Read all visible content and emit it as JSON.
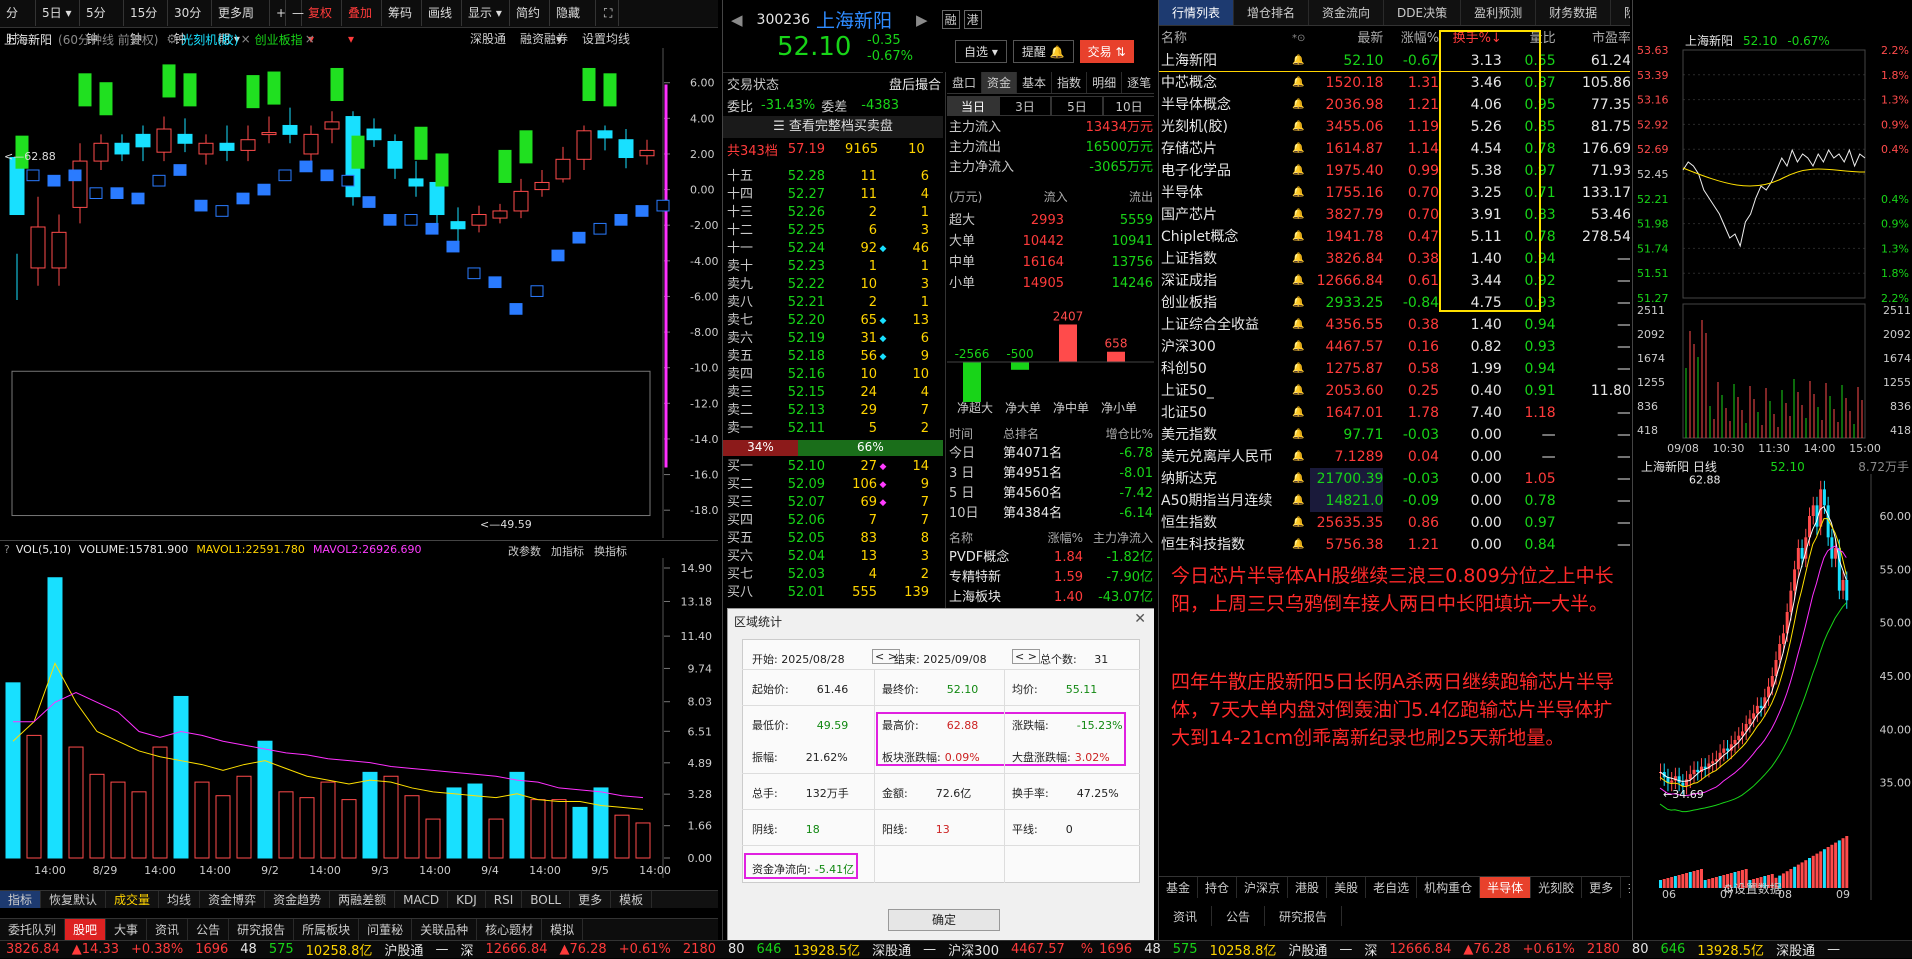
{
  "toolbar": {
    "items": [
      "分时",
      "5日",
      "5分钟",
      "15分钟",
      "30分钟",
      "更多周期",
      "+",
      "—",
      "复权",
      "叠加",
      "筹码",
      "画线",
      "显示",
      "简约",
      "隐藏"
    ]
  },
  "left_chart": {
    "title": "上海新阳",
    "subtitle": "(60分钟线 前复权)",
    "tag1": "光刻机(胶)",
    "tag2": "创业板指",
    "menu": [
      "深股通",
      "融资融券",
      "设置均线"
    ],
    "high_label": "62.88",
    "low_label": "49.59",
    "y_ticks": [
      "6.00",
      "4.00",
      "2.00",
      "0.00",
      "-2.00",
      "-4.00",
      "-6.00",
      "-8.00",
      "-10.00",
      "-12.00",
      "-14.00",
      "-16.00",
      "-18.00"
    ]
  },
  "vol_chart": {
    "title": "VOL(5,10)",
    "volume": "VOLUME:15781.900",
    "mavol1": "MAVOL1:22591.780",
    "mavol2": "MAVOL2:26926.690",
    "menu": [
      "改参数",
      "加指标",
      "换指标"
    ],
    "y_ticks": [
      "14.90",
      "13.18",
      "11.40",
      "9.74",
      "8.03",
      "6.51",
      "4.89",
      "3.28",
      "1.66",
      "0.00"
    ],
    "x_ticks": [
      "14:00",
      "8/29",
      "14:00",
      "14:00",
      "9/2",
      "14:00",
      "9/3",
      "14:00",
      "9/4",
      "14:00",
      "9/5",
      "14:00"
    ]
  },
  "indicator_tabs": [
    "指标",
    "恢复默认",
    "成交量",
    "均线",
    "资金博弈",
    "资金趋势",
    "两融差额",
    "MACD",
    "KDJ",
    "RSI",
    "BOLL",
    "更多",
    "模板"
  ],
  "bottom_tabs": [
    "委托队列",
    "股吧",
    "大事",
    "资讯",
    "公告",
    "研究报告",
    "所属板块",
    "问董秘",
    "关联品种",
    "核心题材",
    "模拟"
  ],
  "quote": {
    "code": "300236",
    "name": "上海新阳",
    "tag1": "融",
    "tag2": "港",
    "price": "52.10",
    "chg": "-0.35",
    "pct": "-0.67%",
    "btn_watch": "自选",
    "btn_alert": "提醒",
    "btn_trade": "交易",
    "state_label": "交易状态",
    "state": "盘后撮合",
    "wb_label": "委比",
    "wb": "-31.43%",
    "wc_label": "委差",
    "wc": "-4383",
    "full_book": "查看完整档买卖盘",
    "total_label": "共343档",
    "total_price": "57.19",
    "total_vol": "9165",
    "total_n": "10",
    "ratio_sell": "34%",
    "ratio_buy": "66%"
  },
  "sell_book": [
    [
      "十五",
      "52.28",
      "11",
      "6"
    ],
    [
      "十四",
      "52.27",
      "11",
      "4"
    ],
    [
      "十三",
      "52.26",
      "2",
      "1"
    ],
    [
      "十二",
      "52.25",
      "6",
      "3"
    ],
    [
      "十一",
      "52.24",
      "92",
      "46"
    ],
    [
      "卖十",
      "52.23",
      "1",
      "1"
    ],
    [
      "卖九",
      "52.22",
      "10",
      "3"
    ],
    [
      "卖八",
      "52.21",
      "2",
      "1"
    ],
    [
      "卖七",
      "52.20",
      "65",
      "13"
    ],
    [
      "卖六",
      "52.19",
      "31",
      "6"
    ],
    [
      "卖五",
      "52.18",
      "56",
      "9"
    ],
    [
      "卖四",
      "52.16",
      "10",
      "10"
    ],
    [
      "卖三",
      "52.15",
      "24",
      "4"
    ],
    [
      "卖二",
      "52.13",
      "29",
      "7"
    ],
    [
      "卖一",
      "52.11",
      "5",
      "2"
    ]
  ],
  "buy_book": [
    [
      "买一",
      "52.10",
      "27",
      "14"
    ],
    [
      "买二",
      "52.09",
      "106",
      "9"
    ],
    [
      "买三",
      "52.07",
      "69",
      "7"
    ],
    [
      "买四",
      "52.06",
      "7",
      "7"
    ],
    [
      "买五",
      "52.05",
      "83",
      "8"
    ],
    [
      "买六",
      "52.04",
      "13",
      "3"
    ],
    [
      "买七",
      "52.03",
      "4",
      "2"
    ],
    [
      "买八",
      "52.01",
      "555",
      "139"
    ]
  ],
  "fund": {
    "tabs": [
      "盘口",
      "资金",
      "基本",
      "指数",
      "明细",
      "逐笔"
    ],
    "periods": [
      "当日",
      "3日",
      "5日",
      "10日"
    ],
    "main_in_label": "主力流入",
    "main_in": "13434万元",
    "main_out_label": "主力流出",
    "main_out": "16500万元",
    "main_net_label": "主力净流入",
    "main_net": "-3065万元",
    "unit": "(万元)",
    "in": "流入",
    "out": "流出",
    "rows": [
      [
        "超大",
        "2993",
        "5559"
      ],
      [
        "大单",
        "10442",
        "10941"
      ],
      [
        "中单",
        "16164",
        "13756"
      ],
      [
        "小单",
        "14905",
        "14246"
      ]
    ],
    "bars": [
      {
        "label": "净超大",
        "value": -2566
      },
      {
        "label": "净大单",
        "value": -500
      },
      {
        "label": "净中单",
        "value": 2407
      },
      {
        "label": "净小单",
        "value": 658
      }
    ],
    "rank_head": [
      "时间",
      "总排名",
      "增仓比%"
    ],
    "ranks": [
      [
        "今日",
        "第4071名",
        "-6.78"
      ],
      [
        "3 日",
        "第4951名",
        "-8.01"
      ],
      [
        "5 日",
        "第4560名",
        "-7.42"
      ],
      [
        "10日",
        "第4384名",
        "-6.14"
      ]
    ],
    "sector_head": [
      "名称",
      "涨幅%",
      "主力净流入"
    ],
    "sectors": [
      [
        "PVDF概念",
        "1.84",
        "-1.82亿"
      ],
      [
        "专精特新",
        "1.59",
        "-7.90亿"
      ],
      [
        "上海板块",
        "1.40",
        "-43.07亿"
      ]
    ]
  },
  "watch": {
    "tabs": [
      "行情列表",
      "增仓排名",
      "资金流向",
      "DDE决策",
      "盈利预测",
      "财务数据",
      "阶段统计",
      "多股同列"
    ],
    "head": [
      "名称",
      "最新",
      "涨幅%",
      "换手%",
      "量比",
      "市盈率"
    ],
    "rows": [
      [
        "上海新阳",
        "52.10",
        "-0.67",
        "3.13",
        "0.55",
        "61.24"
      ],
      [
        "中芯概念",
        "1520.18",
        "1.31",
        "3.46",
        "0.87",
        "105.86"
      ],
      [
        "半导体概念",
        "2036.98",
        "1.21",
        "4.06",
        "0.95",
        "77.35"
      ],
      [
        "光刻机(胶)",
        "3455.06",
        "1.19",
        "5.26",
        "0.85",
        "81.75"
      ],
      [
        "存储芯片",
        "1614.87",
        "1.14",
        "4.54",
        "0.78",
        "176.69"
      ],
      [
        "电子化学品",
        "1975.40",
        "0.99",
        "5.38",
        "0.97",
        "71.93"
      ],
      [
        "半导体",
        "1755.16",
        "0.70",
        "3.25",
        "0.71",
        "133.17"
      ],
      [
        "国产芯片",
        "3827.79",
        "0.70",
        "3.91",
        "0.83",
        "53.46"
      ],
      [
        "Chiplet概念",
        "1941.78",
        "0.47",
        "5.11",
        "0.78",
        "278.54"
      ],
      [
        "上证指数",
        "3826.84",
        "0.38",
        "1.40",
        "0.94",
        "—"
      ],
      [
        "深证成指",
        "12666.84",
        "0.61",
        "3.44",
        "0.92",
        "—"
      ],
      [
        "创业板指",
        "2933.25",
        "-0.84",
        "4.75",
        "0.93",
        "—"
      ],
      [
        "上证综合全收益",
        "4356.55",
        "0.38",
        "1.40",
        "0.94",
        "—"
      ],
      [
        "沪深300",
        "4467.57",
        "0.16",
        "0.82",
        "0.93",
        "—"
      ],
      [
        "科创50",
        "1275.87",
        "0.58",
        "1.99",
        "0.94",
        "—"
      ],
      [
        "上证50_",
        "2053.60",
        "0.25",
        "0.40",
        "0.91",
        "11.80"
      ],
      [
        "北证50",
        "1647.01",
        "1.78",
        "7.40",
        "1.18",
        "—"
      ],
      [
        "美元指数",
        "97.71",
        "-0.03",
        "0.00",
        "—",
        "—"
      ],
      [
        "美元兑离岸人民币",
        "7.1289",
        "0.04",
        "0.00",
        "—",
        "—"
      ],
      [
        "纳斯达克",
        "21700.39",
        "-0.03",
        "0.00",
        "1.05",
        "—"
      ],
      [
        "A50期指当月连续",
        "14821.0",
        "-0.09",
        "0.00",
        "0.78",
        "—"
      ],
      [
        "恒生指数",
        "25635.35",
        "0.86",
        "0.00",
        "0.97",
        "—"
      ],
      [
        "恒生科技指数",
        "5756.38",
        "1.21",
        "0.00",
        "0.84",
        "—"
      ]
    ],
    "bottom_tabs": [
      "基金",
      "持仓",
      "沪深京",
      "港股",
      "美股",
      "老自选",
      "机构重仓",
      "半导体",
      "光刻胶",
      "更多",
      "抓牛机会..."
    ],
    "settings": "设置数据",
    "sub_tabs": [
      "资讯",
      "公告",
      "研究报告"
    ]
  },
  "annotation": {
    "p1": "今日芯片半导体AH股继续三浪三0.809分位之上中长阳，上周三只乌鸦倒车接人两日中长阳填坑一大半。",
    "p2": "四年牛散庄股新阳5日长阴A杀两日继续跑输芯片半导体，7天大单内盘对倒轰油门5.4亿跑输芯片半导体扩大到14-21cm创乖离新纪录也刷25天新地量。"
  },
  "mini_intraday": {
    "name": "上海新阳",
    "price": "52.10",
    "pct": "-0.67%",
    "y_left": [
      "53.63",
      "53.39",
      "53.16",
      "52.92",
      "52.69",
      "52.45",
      "52.21",
      "51.98",
      "51.74",
      "51.51",
      "51.27"
    ],
    "y_right": [
      "2.2%",
      "1.8%",
      "1.3%",
      "0.9%",
      "0.4%",
      "0.4%",
      "0.9%",
      "1.3%",
      "1.8%",
      "2.2%"
    ],
    "vol_ticks": [
      "2511",
      "2092",
      "1674",
      "1255",
      "836",
      "418"
    ],
    "x": [
      "09/08",
      "10:30",
      "11:30",
      "14:00",
      "15:00"
    ]
  },
  "mini_daily": {
    "name": "上海新阳 日线",
    "price": "52.10",
    "vol": "8.72万手",
    "high": "62.88",
    "low": "34.69",
    "y": [
      "60.00",
      "55.00",
      "50.00",
      "45.00",
      "40.00",
      "35.00"
    ],
    "x": [
      "06",
      "07",
      "08",
      "09"
    ]
  },
  "dialog": {
    "title": "区域统计",
    "start_label": "开始:",
    "start": "2025/08/28",
    "end_label": "结束:",
    "end": "2025/09/08",
    "count_label": "总个数:",
    "count": "31",
    "open_label": "起始价:",
    "open": "61.46",
    "last_label": "最终价:",
    "last": "52.10",
    "avg_label": "均价:",
    "avg": "55.11",
    "low_label": "最低价:",
    "low": "49.59",
    "high_label": "最高价:",
    "high": "62.88",
    "chg_label": "涨跌幅:",
    "chg": "-15.23%",
    "amp_label": "振幅:",
    "amp": "21.62%",
    "sector_label": "板块涨跌幅:",
    "sector": "0.09%",
    "market_label": "大盘涨跌幅:",
    "market": "3.02%",
    "hands_label": "总手:",
    "hands": "132万手",
    "amount_label": "金额:",
    "amount": "72.6亿",
    "turn_label": "换手率:",
    "turn": "47.25%",
    "yin_label": "阴线:",
    "yin": "18",
    "yang_label": "阳线:",
    "yang": "13",
    "flat_label": "平线:",
    "flat": "0",
    "net_label": "资金净流向:",
    "net": "-5.41亿",
    "ok": "确定"
  },
  "status": {
    "sh": "3826.84",
    "sh_chg": "▲14.33",
    "sh_pct": "+0.38%",
    "sh_up": "1696",
    "sh_flat": "48",
    "sh_dn": "575",
    "sh_amt": "10258.8亿",
    "hgt": "沪股通",
    "sz_label": "深",
    "sz": "12666.84",
    "sz_chg": "▲76.28",
    "sz_pct": "+0.61%",
    "sz_up": "2180",
    "sz_flat": "80",
    "sz_dn": "646",
    "sz_amt": "13928.5亿",
    "sgt": "深股通",
    "hs300_label": "沪深300",
    "hs300": "4467.57"
  },
  "chart_data": {
    "type": "candlestick",
    "series_candles": [
      [
        5.2,
        2.0,
        -0.2,
        -2.8
      ],
      [
        -1.0,
        1.3,
        -2.0,
        3.0
      ],
      [
        -1.0,
        1.0,
        -2.0,
        2.0
      ],
      [
        2.4,
        5.0,
        1.5,
        6.0
      ],
      [
        5.0,
        6.0,
        4.5,
        6.5
      ],
      [
        6.0,
        5.4,
        5.0,
        6.5
      ],
      [
        6.5,
        5.8,
        5.0,
        7.0
      ],
      [
        5.5,
        6.8,
        5.0,
        7.5
      ],
      [
        6.5,
        6.0,
        5.5,
        7.4
      ],
      [
        5.4,
        6.0,
        4.8,
        6.5
      ],
      [
        6.0,
        5.6,
        5.0,
        7.0
      ],
      [
        5.6,
        6.2,
        5.0,
        7.0
      ],
      [
        6.5,
        6.6,
        6.0,
        7.5
      ],
      [
        7.0,
        6.5,
        6.0,
        8.0
      ],
      [
        5.4,
        6.5,
        5.0,
        7.0
      ],
      [
        6.8,
        7.2,
        6.0,
        7.8
      ],
      [
        7.5,
        3.0,
        2.5,
        7.8
      ],
      [
        6.8,
        6.2,
        5.8,
        7.4
      ],
      [
        6.1,
        4.6,
        4.0,
        6.5
      ],
      [
        4.0,
        3.6,
        3.0,
        5.0
      ],
      [
        3.8,
        2.0,
        1.5,
        4.0
      ],
      [
        1.6,
        1.2,
        0.5,
        2.4
      ],
      [
        1.4,
        2.0,
        1.0,
        2.5
      ],
      [
        1.8,
        2.2,
        1.5,
        2.6
      ],
      [
        2.2,
        3.3,
        1.8,
        4.0
      ],
      [
        3.4,
        3.8,
        3.0,
        4.5
      ],
      [
        4.0,
        5.1,
        3.8,
        5.8
      ],
      [
        5.1,
        6.7,
        4.5,
        7.0
      ],
      [
        6.7,
        6.3,
        5.6,
        7.0
      ],
      [
        6.2,
        5.2,
        4.6,
        6.8
      ],
      [
        5.3,
        5.6,
        4.8,
        6.2
      ]
    ]
  }
}
